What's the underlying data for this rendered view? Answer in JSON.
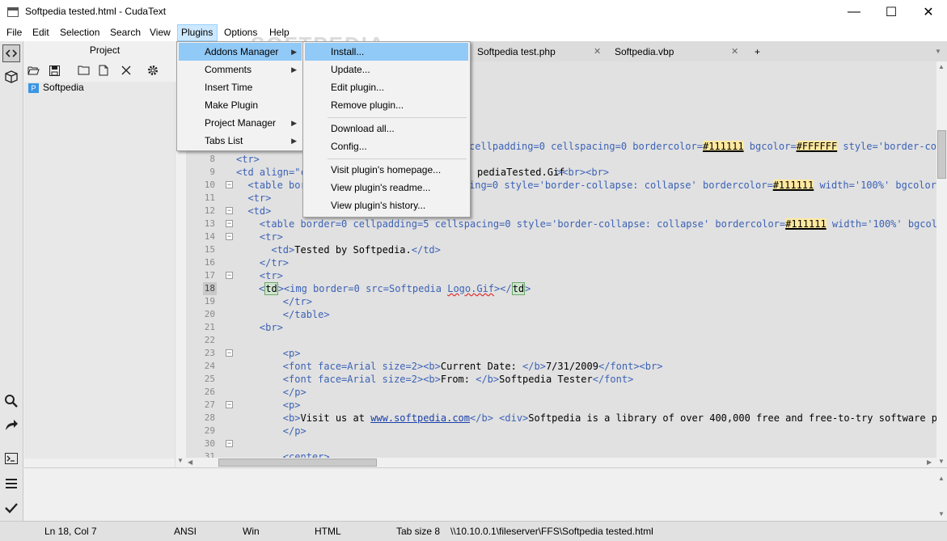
{
  "window": {
    "title": "Softpedia tested.html - CudaText",
    "min_glyph": "—",
    "max_glyph": "☐",
    "close_glyph": "✕"
  },
  "menubar": {
    "items": [
      "File",
      "Edit",
      "Selection",
      "Search",
      "View",
      "Plugins",
      "Options",
      "Help"
    ]
  },
  "watermark": "SOFTPEDIA",
  "project": {
    "title": "Project",
    "tree_item": "Softpedia",
    "tree_item_icon": "P"
  },
  "tabs": [
    {
      "label": "Softpedia test.php",
      "close": "✕"
    },
    {
      "label": "Softpedia.vbp",
      "close": "✕"
    },
    {
      "label": "+",
      "close": ""
    }
  ],
  "plugins_menu": {
    "items": [
      "Addons Manager",
      "Comments",
      "Insert Time",
      "Make Plugin",
      "Project Manager",
      "Tabs List"
    ]
  },
  "addons_menu": {
    "items": [
      "Install...",
      "Update...",
      "Edit plugin...",
      "Remove plugin...",
      "Download all...",
      "Config...",
      "Visit plugin's homepage...",
      "View plugin's readme...",
      "View plugin's history..."
    ]
  },
  "gutter": {
    "line_numbers": [
      "8",
      "9",
      "10",
      "11",
      "12",
      "13",
      "14",
      "15",
      "16",
      "17",
      "18",
      "19",
      "20",
      "21",
      "22",
      "23",
      "24",
      "25",
      "26",
      "27",
      "28",
      "29",
      "30",
      "31"
    ]
  },
  "code": {
    "l7_a": "cellpadding=0 cellspacing=0 bordercolor=",
    "l7_b": "#111111",
    "l7_c": " bgcolor=",
    "l7_d": "#FFFFFF",
    "l7_e": " style='border-colla",
    "l8": "<tr>",
    "l9_a": "<td align=\"c",
    "l9_b": "pediaTested.Gif",
    "l9_c": "><br><br>",
    "l10_a": "  <table bor",
    "l10_b": "ing=0 style='border-collapse: collapse' bordercolor=",
    "l10_c": "#111111",
    "l10_d": " width='100%' bgcolor=#",
    "l11": "  <tr>",
    "l12": "  <td>",
    "l13_a": "    <table border=0 cellpadding=5 cellspacing=0 style='border-collapse: collapse' bordercolor=",
    "l13_b": "#111111",
    "l13_c": " width='100%' bgcolor=#",
    "l14": "    <tr>",
    "l15_a": "      <td>",
    "l15_b": "Tested by Softpedia.",
    "l15_c": "</td>",
    "l16": "    </tr>",
    "l17": "    <tr>",
    "l18_a": "td",
    "l18_b": "<img border=0 src=Softpedia ",
    "l18_c": "Logo.Gif",
    "l18_d": "></",
    "l18_e": "td",
    "l18_f": ">",
    "l19": "        </tr>",
    "l20": "        </table>",
    "l21": "    <br>",
    "l23": "        <p>",
    "l24_a": "        <font face=Arial size=2><b>",
    "l24_b": "Current Date: ",
    "l24_c": "</b>",
    "l24_d": "7/31/2009",
    "l24_e": "</font><br>",
    "l25_a": "        <font face=Arial size=2><b>",
    "l25_b": "From: ",
    "l25_c": "</b>",
    "l25_d": "Softpedia Tester",
    "l25_e": "</font>",
    "l26": "        </p>",
    "l27": "        <p>",
    "l28_a": "        <b>",
    "l28_b": "Visit us at ",
    "l28_c": "www.softpedia.com",
    "l28_d": "</b> <div>",
    "l28_e": "Softpedia is a library of over 400,000 free and free-to-try software progr",
    "l29": "        </p>",
    "l31": "        <center>"
  },
  "statusbar": {
    "position": "Ln 18, Col 7",
    "encoding": "ANSI",
    "line_ending": "Win",
    "lexer": "HTML",
    "tab_size": "Tab size 8",
    "path": "\\\\10.10.0.1\\fileserver\\FFS\\Softpedia tested.html"
  }
}
